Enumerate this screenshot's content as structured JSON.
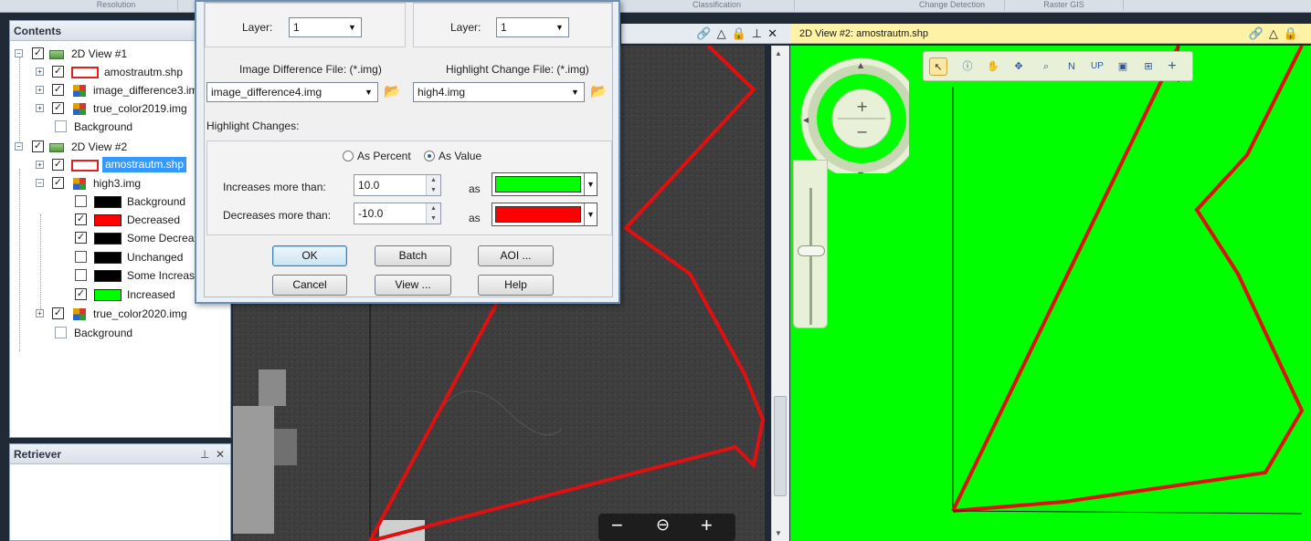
{
  "ribbon": {
    "tabs": [
      "Resolution",
      "Classification",
      "Change Detection",
      "Raster GIS"
    ]
  },
  "contents": {
    "title": "Contents",
    "tree": [
      {
        "label": "2D View #1"
      },
      {
        "label": "amostrautm.shp"
      },
      {
        "label": "image_difference3.im"
      },
      {
        "label": "true_color2019.img"
      },
      {
        "label": "Background"
      },
      {
        "label": "2D View #2"
      },
      {
        "label": "amostrautm.shp"
      },
      {
        "label": "high3.img"
      },
      {
        "label": "Background"
      },
      {
        "label": "Decreased"
      },
      {
        "label": "Some Decrea"
      },
      {
        "label": "Unchanged"
      },
      {
        "label": "Some Increas"
      },
      {
        "label": "Increased"
      },
      {
        "label": "true_color2020.img"
      },
      {
        "label": "Background"
      }
    ],
    "colors": {
      "decreased": "#ff0000",
      "increased": "#00ff00",
      "black": "#000000"
    }
  },
  "retriever": {
    "title": "Retriever",
    "pin_icon": "pin-icon",
    "close_icon": "close-icon"
  },
  "view1": {
    "header_icons": [
      "link-icon",
      "triangle-icon",
      "lock-icon",
      "pin-icon",
      "close-icon"
    ]
  },
  "view2": {
    "title": "2D View #2: amostrautm.shp"
  },
  "dialog": {
    "layer_label_left": "Layer:",
    "layer_value_left": "1",
    "layer_label_right": "Layer:",
    "layer_value_right": "1",
    "image_diff_label": "Image Difference File: (*.img)",
    "image_diff_value": "image_difference4.img",
    "highlight_file_label": "Highlight Change File: (*.img)",
    "highlight_file_value": "high4.img",
    "highlight_changes_label": "Highlight Changes:",
    "as_percent": "As Percent",
    "as_value": "As Value",
    "increases_label": "Increases more than:",
    "increases_value": "10.0",
    "decreases_label": "Decreases more than:",
    "decreases_value": "-10.0",
    "as1": "as",
    "as2": "as",
    "increase_color": "#00ff00",
    "decrease_color": "#ff0000",
    "ok": "OK",
    "batch": "Batch",
    "aoi": "AOI ...",
    "cancel": "Cancel",
    "view": "View ...",
    "help": "Help"
  },
  "bottom_zoom": {
    "minus": "−",
    "zoom_icon": "zoom-icon",
    "plus": "+"
  }
}
